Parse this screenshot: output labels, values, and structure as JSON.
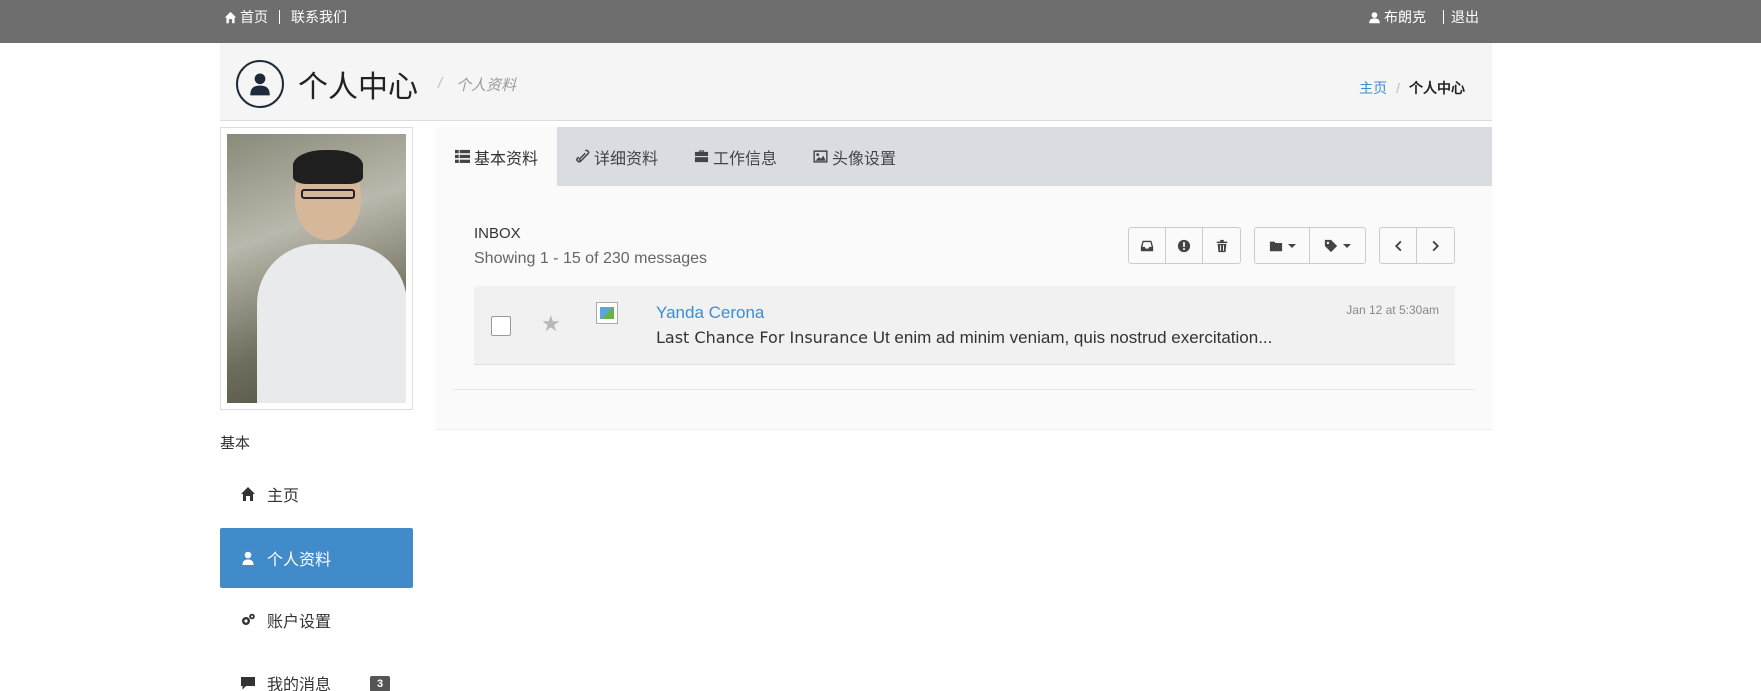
{
  "topbar": {
    "home_label": "首页",
    "contact_label": "联系我们",
    "user_label": "布朗克",
    "logout_label": "退出"
  },
  "header": {
    "title": "个人中心",
    "subtitle": "个人资料",
    "breadcrumb": {
      "home": "主页",
      "current": "个人中心"
    }
  },
  "sidebar": {
    "heading": "基本",
    "items": [
      {
        "label": "主页",
        "icon": "home-icon"
      },
      {
        "label": "个人资料",
        "icon": "user-icon",
        "active": true
      },
      {
        "label": "账户设置",
        "icon": "gears-icon"
      },
      {
        "label": "我的消息",
        "icon": "comment-icon",
        "badge": "3"
      }
    ]
  },
  "tabs": [
    {
      "label": "基本资料",
      "icon": "list-icon",
      "active": true
    },
    {
      "label": "详细资料",
      "icon": "paperclip-icon"
    },
    {
      "label": "工作信息",
      "icon": "briefcase-icon"
    },
    {
      "label": "头像设置",
      "icon": "image-icon"
    }
  ],
  "inbox": {
    "title": "INBOX",
    "count_text": "Showing 1 - 15 of 230 messages",
    "toolbar_icons": [
      "inbox-icon",
      "exclamation-icon",
      "trash-icon",
      "folder-icon",
      "tag-icon",
      "chevron-left-icon",
      "chevron-right-icon"
    ],
    "messages": [
      {
        "sender": "Yanda Cerona",
        "subject": "Last Chance For Insurance",
        "preview": " Ut enim ad minim veniam, quis nostrud exercitation...",
        "date": "Jan 12 at 5:30am"
      }
    ]
  },
  "colors": {
    "accent": "#428bca",
    "link": "#3a8ed4",
    "topbar": "#6e6e6e",
    "tabbar": "#d9dde1"
  }
}
